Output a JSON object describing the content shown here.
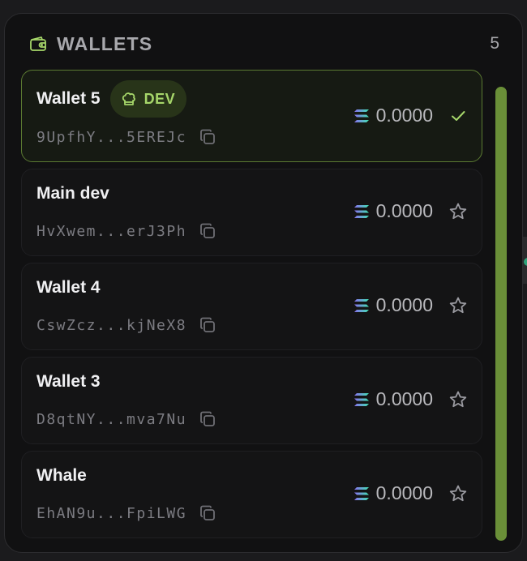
{
  "header": {
    "icon": "wallet-icon",
    "title": "WALLETS",
    "count": "5"
  },
  "colors": {
    "accent": "#a6d66a",
    "selected_border": "#5b7a32",
    "scrollbar": "#6a8f38"
  },
  "wallets": [
    {
      "name": "Wallet 5",
      "badge": "DEV",
      "badge_icon": "chef-hat-icon",
      "address": "9UpfhY...5EREJc",
      "balance": "0.0000",
      "selected": true,
      "action_icon": "check-icon"
    },
    {
      "name": "Main dev",
      "address": "HvXwem...erJ3Ph",
      "balance": "0.0000",
      "selected": false,
      "action_icon": "star-icon"
    },
    {
      "name": "Wallet 4",
      "address": "CswZcz...kjNeX8",
      "balance": "0.0000",
      "selected": false,
      "action_icon": "star-icon"
    },
    {
      "name": "Wallet 3",
      "address": "D8qtNY...mva7Nu",
      "balance": "0.0000",
      "selected": false,
      "action_icon": "star-icon"
    },
    {
      "name": "Whale",
      "address": "EhAN9u...FpiLWG",
      "balance": "0.0000",
      "selected": false,
      "action_icon": "star-icon"
    }
  ]
}
